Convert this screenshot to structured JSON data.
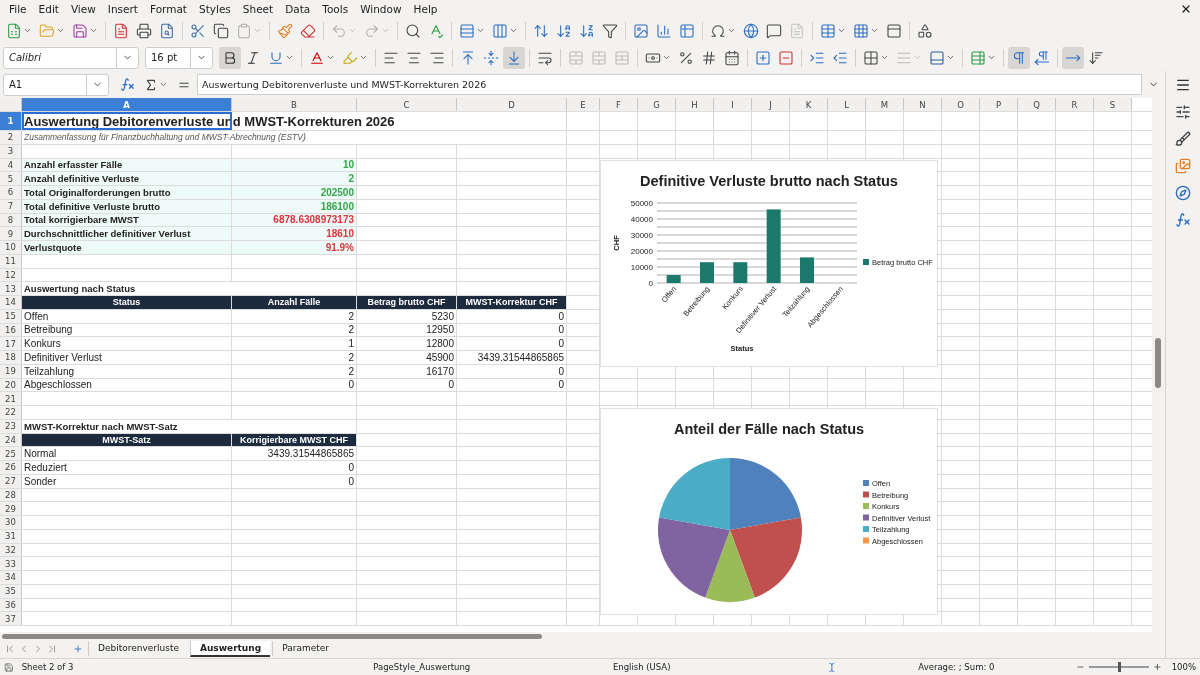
{
  "menu": [
    "File",
    "Edit",
    "View",
    "Insert",
    "Format",
    "Styles",
    "Sheet",
    "Data",
    "Tools",
    "Window",
    "Help"
  ],
  "standard_toolbar": [
    {
      "kind": "new",
      "dropdown": true,
      "disabled": false
    },
    {
      "kind": "open",
      "dropdown": true,
      "disabled": false
    },
    {
      "kind": "save",
      "dropdown": true,
      "disabled": false
    },
    {
      "kind": "separator"
    },
    {
      "kind": "export_pdf",
      "dropdown": false,
      "disabled": false
    },
    {
      "kind": "print",
      "dropdown": false,
      "disabled": false
    },
    {
      "kind": "print_preview",
      "dropdown": false,
      "disabled": false
    },
    {
      "kind": "separator"
    },
    {
      "kind": "cut",
      "dropdown": false,
      "disabled": false
    },
    {
      "kind": "copy",
      "dropdown": false,
      "disabled": false
    },
    {
      "kind": "paste",
      "dropdown": true,
      "disabled": true
    },
    {
      "kind": "separator"
    },
    {
      "kind": "clone",
      "dropdown": false,
      "disabled": false
    },
    {
      "kind": "clear",
      "dropdown": false,
      "disabled": false
    },
    {
      "kind": "separator"
    },
    {
      "kind": "undo",
      "dropdown": true,
      "disabled": true
    },
    {
      "kind": "redo",
      "dropdown": true,
      "disabled": true
    },
    {
      "kind": "separator"
    },
    {
      "kind": "find_replace",
      "dropdown": false,
      "disabled": false
    },
    {
      "kind": "spelling",
      "dropdown": false,
      "disabled": false
    },
    {
      "kind": "separator"
    },
    {
      "kind": "row",
      "dropdown": true,
      "disabled": false
    },
    {
      "kind": "column",
      "dropdown": true,
      "disabled": false
    },
    {
      "kind": "separator"
    },
    {
      "kind": "sort",
      "dropdown": false,
      "disabled": false
    },
    {
      "kind": "sort_ascending",
      "dropdown": false,
      "disabled": false
    },
    {
      "kind": "sort_descending",
      "dropdown": false,
      "disabled": false
    },
    {
      "kind": "autofilter",
      "dropdown": false,
      "disabled": false
    },
    {
      "kind": "separator"
    },
    {
      "kind": "image",
      "dropdown": false,
      "disabled": false
    },
    {
      "kind": "chart",
      "dropdown": false,
      "disabled": false
    },
    {
      "kind": "pivot_table",
      "dropdown": false,
      "disabled": false
    },
    {
      "kind": "separator"
    },
    {
      "kind": "special_character",
      "dropdown": true,
      "disabled": false
    },
    {
      "kind": "hyperlink",
      "dropdown": false,
      "disabled": false
    },
    {
      "kind": "comment",
      "dropdown": false,
      "disabled": false
    },
    {
      "kind": "header_footer",
      "dropdown": false,
      "disabled": true
    },
    {
      "kind": "separator"
    },
    {
      "kind": "print_area",
      "dropdown": true,
      "disabled": false
    },
    {
      "kind": "freeze",
      "dropdown": true,
      "disabled": false
    },
    {
      "kind": "split_window",
      "dropdown": false,
      "disabled": false
    },
    {
      "kind": "separator"
    },
    {
      "kind": "drawing",
      "dropdown": false,
      "disabled": false
    }
  ],
  "font_name": "Calibri",
  "font_size": "16 pt",
  "formatting_toolbar": [
    {
      "kind": "bold",
      "dropdown": false,
      "on": true,
      "disabled": false
    },
    {
      "kind": "italic",
      "dropdown": false,
      "on": false,
      "disabled": false
    },
    {
      "kind": "underline",
      "dropdown": true,
      "on": false,
      "disabled": false
    },
    {
      "kind": "separator"
    },
    {
      "kind": "font_color",
      "dropdown": true,
      "on": false,
      "disabled": false
    },
    {
      "kind": "highlight",
      "dropdown": true,
      "on": false,
      "disabled": false
    },
    {
      "kind": "separator"
    },
    {
      "kind": "align_left",
      "dropdown": false,
      "on": false,
      "disabled": false
    },
    {
      "kind": "align_center",
      "dropdown": false,
      "on": false,
      "disabled": false
    },
    {
      "kind": "align_right",
      "dropdown": false,
      "on": false,
      "disabled": false
    },
    {
      "kind": "separator"
    },
    {
      "kind": "valign_top",
      "dropdown": false,
      "on": false,
      "disabled": false
    },
    {
      "kind": "valign_center",
      "dropdown": false,
      "on": false,
      "disabled": false
    },
    {
      "kind": "valign_bottom",
      "dropdown": false,
      "on": true,
      "disabled": false
    },
    {
      "kind": "separator"
    },
    {
      "kind": "wrap_text",
      "dropdown": false,
      "on": false,
      "disabled": false
    },
    {
      "kind": "separator"
    },
    {
      "kind": "merge_center",
      "dropdown": false,
      "on": false,
      "disabled": true
    },
    {
      "kind": "merge_cells",
      "dropdown": false,
      "on": false,
      "disabled": true
    },
    {
      "kind": "unmerge_cells",
      "dropdown": false,
      "on": false,
      "disabled": true
    },
    {
      "kind": "separator"
    },
    {
      "kind": "currency",
      "dropdown": true,
      "on": false,
      "disabled": false
    },
    {
      "kind": "percent",
      "dropdown": false,
      "on": false,
      "disabled": false
    },
    {
      "kind": "number",
      "dropdown": false,
      "on": false,
      "disabled": false
    },
    {
      "kind": "date",
      "dropdown": false,
      "on": false,
      "disabled": false
    },
    {
      "kind": "separator"
    },
    {
      "kind": "add_decimal",
      "dropdown": false,
      "on": false,
      "disabled": false
    },
    {
      "kind": "delete_decimal",
      "dropdown": false,
      "on": false,
      "disabled": false
    },
    {
      "kind": "separator"
    },
    {
      "kind": "increase_indent",
      "dropdown": false,
      "on": false,
      "disabled": false
    },
    {
      "kind": "decrease_indent",
      "dropdown": false,
      "on": false,
      "disabled": false
    },
    {
      "kind": "separator"
    },
    {
      "kind": "borders",
      "dropdown": true,
      "on": false,
      "disabled": false
    },
    {
      "kind": "border_style",
      "dropdown": true,
      "on": false,
      "disabled": true
    },
    {
      "kind": "border_color",
      "dropdown": true,
      "on": false,
      "disabled": false
    },
    {
      "kind": "separator"
    },
    {
      "kind": "conditional",
      "dropdown": true,
      "on": false,
      "disabled": false
    },
    {
      "kind": "separator"
    },
    {
      "kind": "paragraph_ltr",
      "dropdown": false,
      "on": true,
      "disabled": false
    },
    {
      "kind": "paragraph_rtl",
      "dropdown": false,
      "on": false,
      "disabled": false
    },
    {
      "kind": "separator"
    },
    {
      "kind": "text_ltr",
      "dropdown": false,
      "on": true,
      "disabled": false
    },
    {
      "kind": "text_ttb",
      "dropdown": false,
      "on": false,
      "disabled": false
    }
  ],
  "formula_bar": {
    "cell_ref": "A1",
    "content": "Auswertung Debitorenverluste und MWST-Korrekturen 2026"
  },
  "column_headers": [
    {
      "label": "A",
      "selected": true
    },
    {
      "label": "B",
      "selected": false
    },
    {
      "label": "C",
      "selected": false
    },
    {
      "label": "D",
      "selected": false
    },
    {
      "label": "E",
      "selected": false
    },
    {
      "label": "F",
      "selected": false
    },
    {
      "label": "G",
      "selected": false
    },
    {
      "label": "H",
      "selected": false
    },
    {
      "label": "I",
      "selected": false
    },
    {
      "label": "J",
      "selected": false
    },
    {
      "label": "K",
      "selected": false
    },
    {
      "label": "L",
      "selected": false
    },
    {
      "label": "M",
      "selected": false
    },
    {
      "label": "N",
      "selected": false
    },
    {
      "label": "O",
      "selected": false
    },
    {
      "label": "P",
      "selected": false
    },
    {
      "label": "Q",
      "selected": false
    },
    {
      "label": "R",
      "selected": false
    },
    {
      "label": "S",
      "selected": false
    }
  ],
  "row_headers": [
    {
      "label": "1",
      "selected": true
    },
    {
      "label": "2",
      "selected": false
    },
    {
      "label": "3",
      "selected": false
    },
    {
      "label": "4",
      "selected": false
    },
    {
      "label": "5",
      "selected": false
    },
    {
      "label": "6",
      "selected": false
    },
    {
      "label": "7",
      "selected": false
    },
    {
      "label": "8",
      "selected": false
    },
    {
      "label": "9",
      "selected": false
    },
    {
      "label": "10",
      "selected": false
    },
    {
      "label": "11",
      "selected": false
    },
    {
      "label": "12",
      "selected": false
    },
    {
      "label": "13",
      "selected": false
    },
    {
      "label": "14",
      "selected": false
    },
    {
      "label": "15",
      "selected": false
    },
    {
      "label": "16",
      "selected": false
    },
    {
      "label": "17",
      "selected": false
    },
    {
      "label": "18",
      "selected": false
    },
    {
      "label": "19",
      "selected": false
    },
    {
      "label": "20",
      "selected": false
    },
    {
      "label": "21",
      "selected": false
    },
    {
      "label": "22",
      "selected": false
    },
    {
      "label": "23",
      "selected": false
    },
    {
      "label": "24",
      "selected": false
    },
    {
      "label": "25",
      "selected": false
    },
    {
      "label": "26",
      "selected": false
    },
    {
      "label": "27",
      "selected": false
    },
    {
      "label": "28",
      "selected": false
    },
    {
      "label": "29",
      "selected": false
    },
    {
      "label": "30",
      "selected": false
    },
    {
      "label": "31",
      "selected": false
    },
    {
      "label": "32",
      "selected": false
    },
    {
      "label": "33",
      "selected": false
    },
    {
      "label": "34",
      "selected": false
    },
    {
      "label": "35",
      "selected": false
    },
    {
      "label": "36",
      "selected": false
    },
    {
      "label": "37",
      "selected": false
    }
  ],
  "sheet": {
    "title": "Auswertung Debitorenverluste und MWST-Korrekturen 2026",
    "subtitle": "Zusammenfassung für Finanzbuchhaltung und MWST-Abrechnung (ESTV)",
    "summary": [
      {
        "label": "Anzahl erfasster Fälle",
        "value": "10",
        "color": "#35a64a"
      },
      {
        "label": "Anzahl definitive Verluste",
        "value": "2",
        "color": "#35a64a"
      },
      {
        "label": "Total Originalforderungen brutto",
        "value": "202500",
        "color": "#35a64a"
      },
      {
        "label": "Total definitive Verluste brutto",
        "value": "186100",
        "color": "#35a64a"
      },
      {
        "label": "Total korrigierbare MWST",
        "value": "6878.6308973173",
        "color": "#d9363e"
      },
      {
        "label": "Durchschnittlicher definitiver Verlust",
        "value": "18610",
        "color": "#d9363e"
      },
      {
        "label": "Verlustquote",
        "value": "91.9%",
        "color": "#d9363e"
      }
    ],
    "status_table": {
      "heading": "Auswertung nach Status",
      "columns": [
        "Status",
        "Anzahl Fälle",
        "Betrag brutto CHF",
        "MWST-Korrektur CHF"
      ],
      "rows": [
        [
          "Offen",
          "2",
          "5230",
          "0"
        ],
        [
          "Betreibung",
          "2",
          "12950",
          "0"
        ],
        [
          "Konkurs",
          "1",
          "12800",
          "0"
        ],
        [
          "Definitiver Verlust",
          "2",
          "45900",
          "3439.31544865865"
        ],
        [
          "Teilzahlung",
          "2",
          "16170",
          "0"
        ],
        [
          "Abgeschlossen",
          "0",
          "0",
          "0"
        ]
      ]
    },
    "vat_table": {
      "heading": "MWST-Korrektur nach MWST-Satz",
      "columns": [
        "MWST-Satz",
        "Korrigierbare MWST CHF"
      ],
      "rows": [
        [
          "Normal",
          "3439.31544865865"
        ],
        [
          "Reduziert",
          "0"
        ],
        [
          "Sonder",
          "0"
        ]
      ]
    }
  },
  "charts": [
    {
      "chart_data": {
        "type": "bar",
        "title": "Definitive Verluste brutto nach Status",
        "xlabel": "Status",
        "ylabel": "CHF",
        "categories": [
          "Offen",
          "Betreibung",
          "Konkurs",
          "Definitiver Verlust",
          "Teilzahlung",
          "Abgeschlossen"
        ],
        "series": [
          {
            "name": "Betrag brutto CHF",
            "color": "#1b7a6b",
            "values": [
              5000,
              13000,
              13000,
              46000,
              16000,
              0
            ]
          }
        ],
        "ylim": [
          0,
          50000
        ],
        "yticks": [
          0,
          10000,
          20000,
          30000,
          40000,
          50000
        ],
        "grid": true,
        "legend": "right"
      }
    },
    {
      "chart_data": {
        "type": "pie",
        "title": "Anteil der Fälle nach Status",
        "categories": [
          "Offen",
          "Betreibung",
          "Konkurs",
          "Definitiver Verlust",
          "Teilzahlung",
          "Abgeschlossen"
        ],
        "values": [
          22.2,
          22.2,
          11.2,
          22.2,
          22.2,
          0
        ],
        "legend": "right",
        "colors": [
          "#4f81bd",
          "#c0504d",
          "#9bbb59",
          "#8064a2",
          "#4bacc6",
          "#f79646"
        ]
      }
    }
  ],
  "sheet_tabs": [
    {
      "label": "Debitorenverluste",
      "selected": false
    },
    {
      "label": "Auswertung",
      "selected": true
    },
    {
      "label": "Parameter",
      "selected": false
    }
  ],
  "status_bar": {
    "sheet": "Sheet 2 of 3",
    "page_style": "PageStyle_Auswertung",
    "language": "English (USA)",
    "summary": "Average: ; Sum: 0",
    "zoom": {
      "level": 0.5,
      "reading": "100%"
    }
  }
}
